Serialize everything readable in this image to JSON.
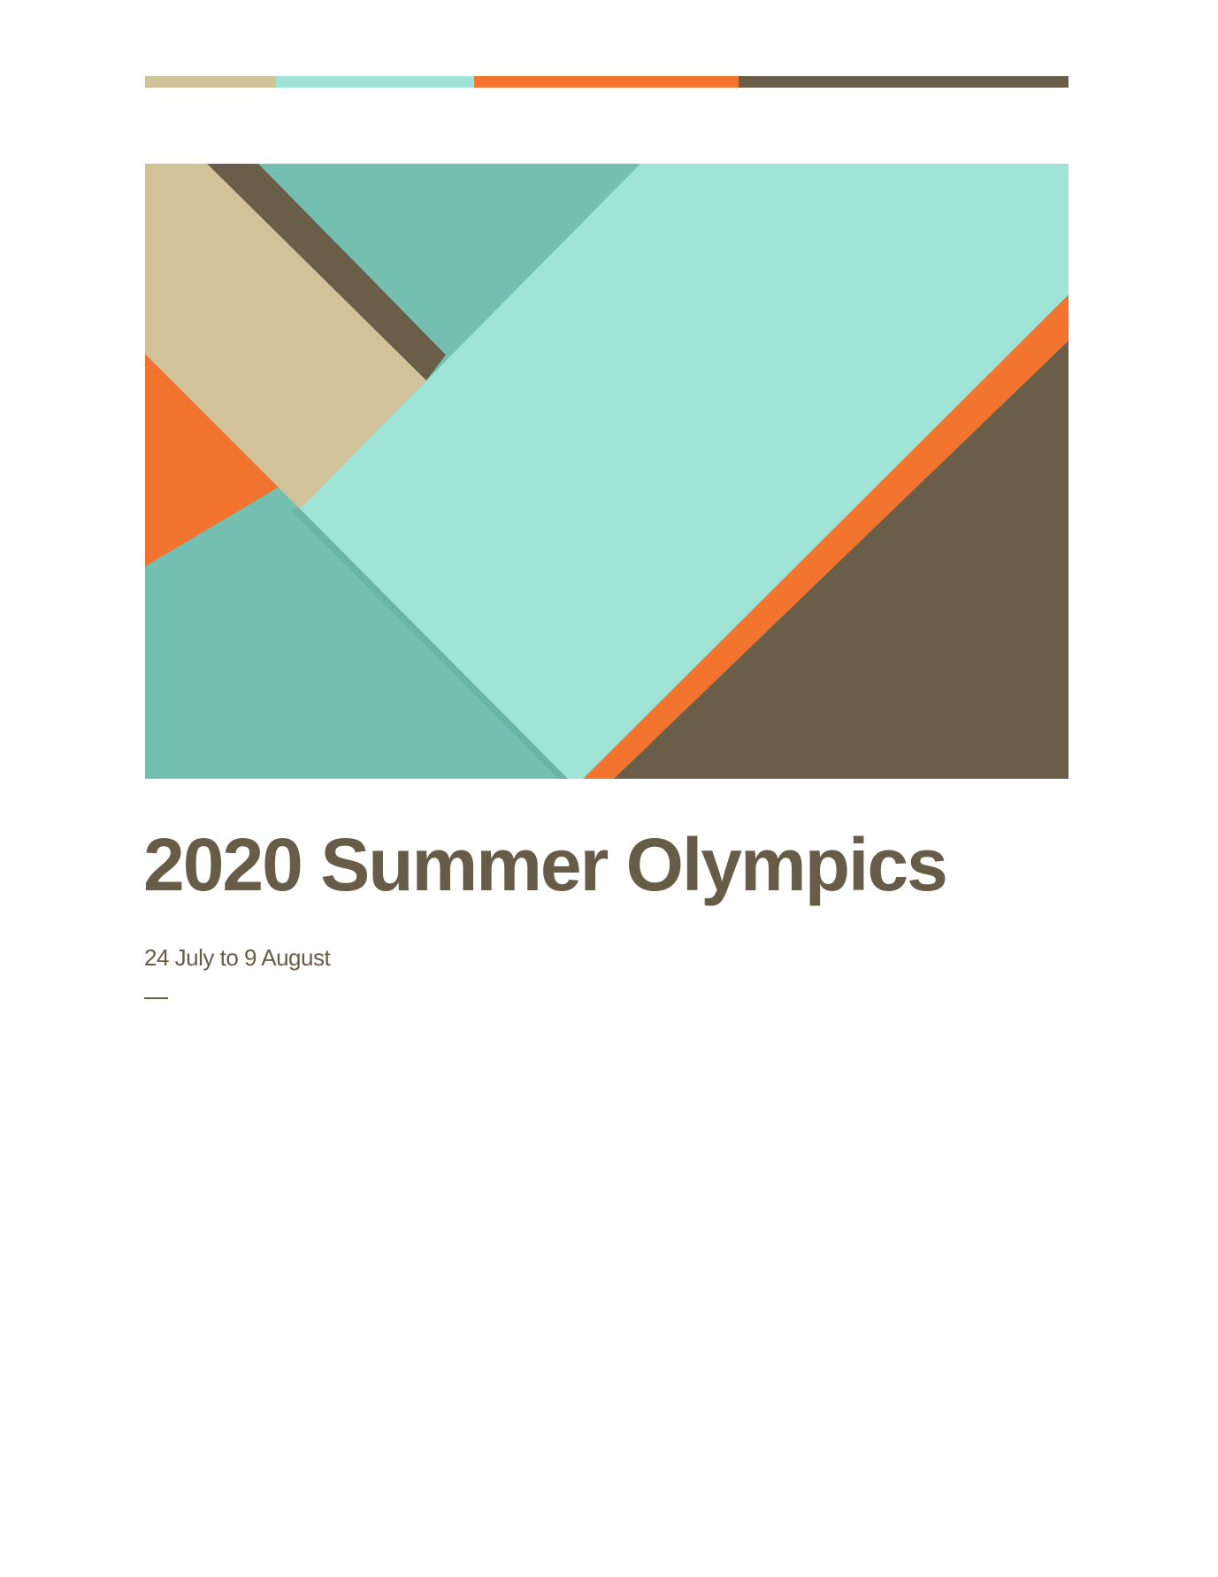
{
  "document": {
    "title": "2020 Summer Olympics",
    "subtitle": "24 July to 9 August"
  },
  "color_bar": {
    "segments": [
      {
        "name": "tan",
        "color": "#d1c29a",
        "fraction": 0.142
      },
      {
        "name": "mint",
        "color": "#a0e4d8",
        "fraction": 0.214
      },
      {
        "name": "orange",
        "color": "#f3742f",
        "fraction": 0.287
      },
      {
        "name": "brown",
        "color": "#6a5e48",
        "fraction": 0.357
      }
    ]
  },
  "palette": {
    "text": "#675c47",
    "tan": "#d1c29a",
    "teal": "#74bfb1",
    "mint": "#a0e4d8",
    "orange": "#f3742f",
    "brown": "#6a5e48"
  },
  "cover_image": {
    "description_icon": "abstract-geometric-art"
  }
}
